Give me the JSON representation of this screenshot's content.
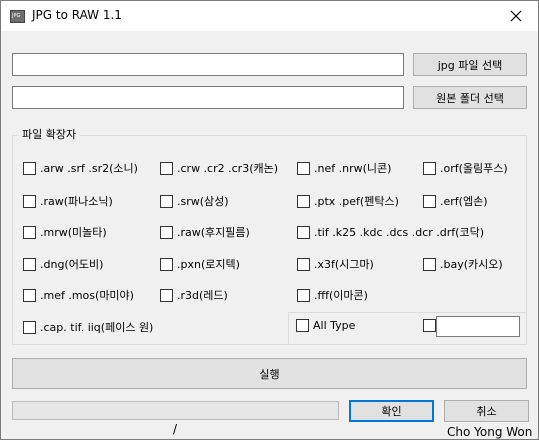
{
  "window": {
    "title": "JPG to RAW 1.1"
  },
  "inputs": {
    "jpg_path": "",
    "raw_folder": ""
  },
  "buttons": {
    "select_jpg": "jpg 파일 선택",
    "select_raw_folder": "원본 폴더 선택",
    "run": "실행",
    "ok": "확인",
    "cancel": "취소"
  },
  "extensions": {
    "group_label": "파일 확장자",
    "items": [
      ".arw .srf .sr2(소니)",
      ".crw .cr2 .cr3(캐논)",
      ".nef .nrw(니콘)",
      ".orf(올림푸스)",
      ".raw(파나소닉)",
      ".srw(삼성)",
      ".ptx .pef(펜탁스)",
      ".erf(엡손)",
      ".mrw(미놀타)",
      ".raw(후지필름)",
      ".tif .k25 .kdc .dcs .dcr .drf(코닥)",
      ".dng(어도비)",
      ".pxn(로지텍)",
      ".x3f(시그마)",
      ".bay(카시오)",
      ".mef .mos(마미야)",
      ".r3d(레드)",
      ".fff(이마콘)",
      ".cap. tif. iiq(페이스 원)"
    ],
    "all_type": "All Type",
    "custom_value": ""
  },
  "status": {
    "progress": 0,
    "marker": "/",
    "author": "Cho Yong Won"
  }
}
